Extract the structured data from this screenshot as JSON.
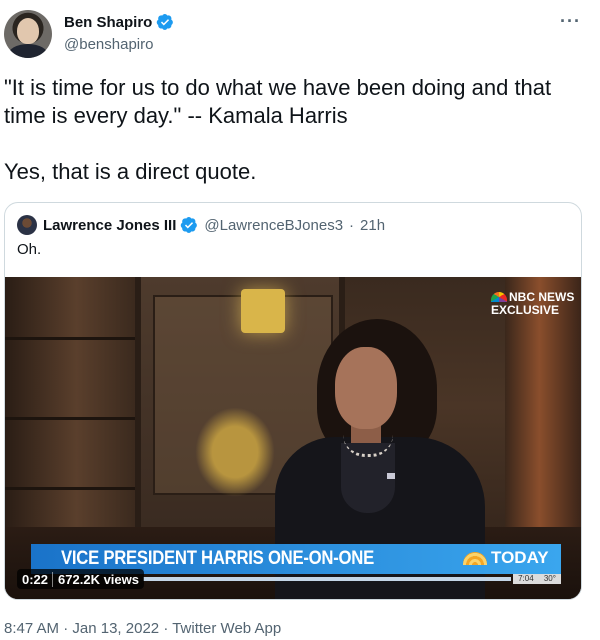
{
  "author": {
    "display_name": "Ben Shapiro",
    "handle": "@benshapiro",
    "verified": true,
    "avatar_icon": "profile-photo"
  },
  "more_label": "···",
  "tweet": {
    "paragraphs": [
      "\"It is time for us to do what we have been doing and that time is every day.\" -- Kamala Harris",
      "Yes, that is a direct quote."
    ]
  },
  "quoted": {
    "display_name": "Lawrence Jones III",
    "handle": "@LawrenceBJones3",
    "separator": "·",
    "age": "21h",
    "text": "Oh.",
    "video": {
      "watermark_line1": "NBC NEWS",
      "watermark_line2": "EXCLUSIVE",
      "lower_third_title": "VICE PRESIDENT HARRIS ONE-ON-ONE",
      "show_logo_text": "TODAY",
      "clock_time": "7:04",
      "clock_temp": "30°",
      "duration": "0:22",
      "views": "672.2K views"
    }
  },
  "footer": {
    "time": "8:47 AM",
    "sep1": "·",
    "date": "Jan 13, 2022",
    "sep2": "·",
    "source": "Twitter Web App"
  },
  "colors": {
    "verified_blue": "#1d9bf0",
    "secondary_text": "#536471",
    "lower_third_blue": "#1a73c9"
  }
}
